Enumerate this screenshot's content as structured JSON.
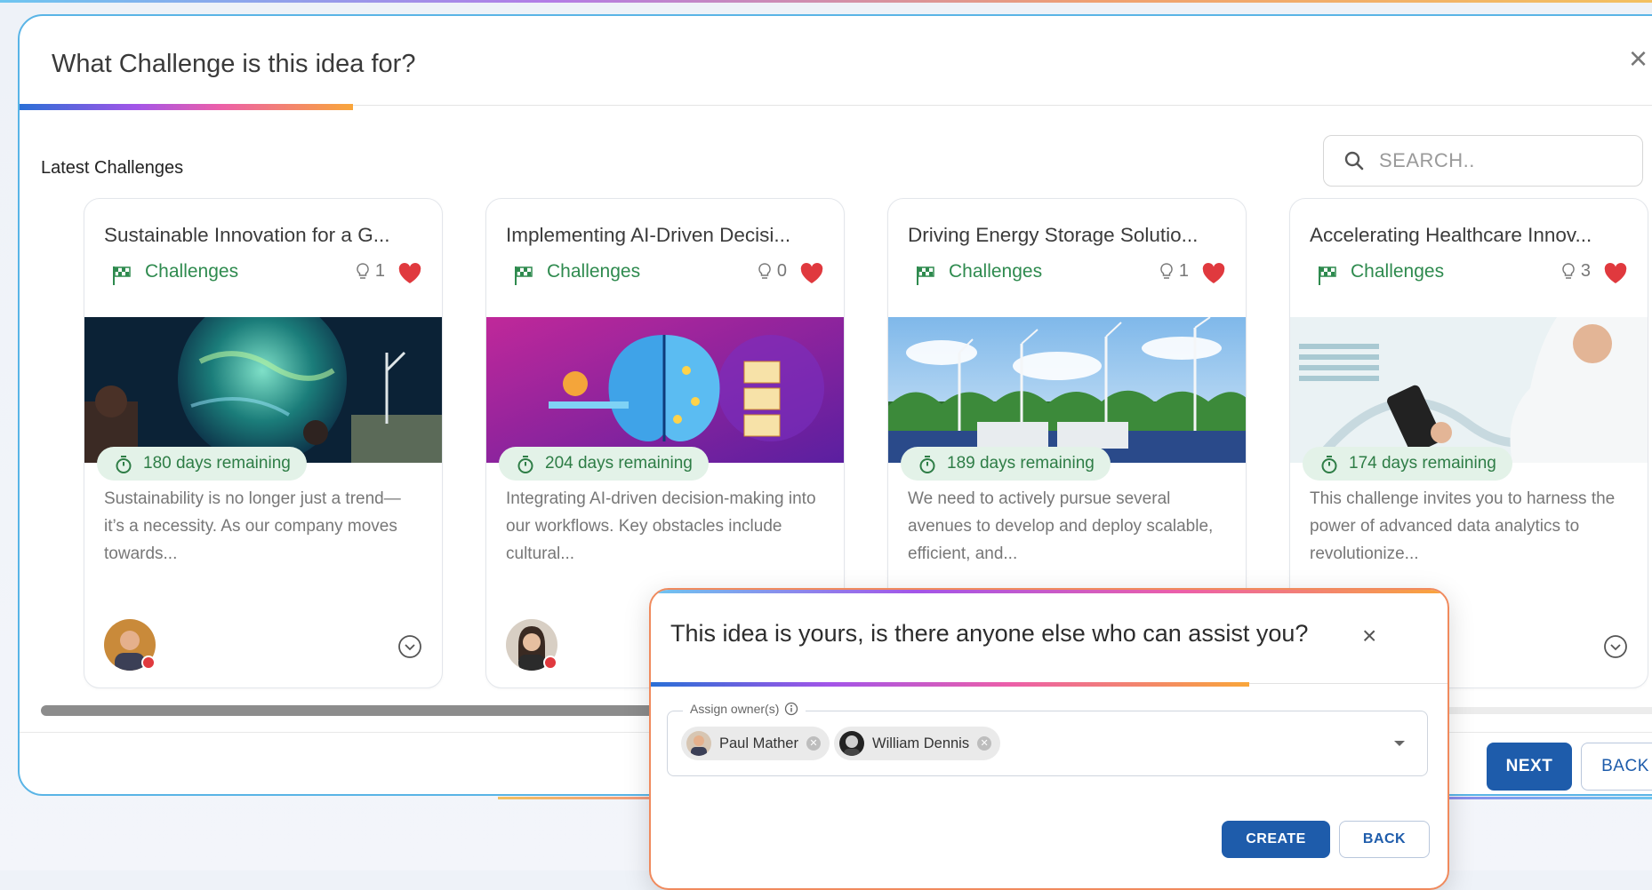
{
  "modal": {
    "title": "What Challenge is this idea for?",
    "close_icon": "×",
    "section_label": "Latest Challenges",
    "search_placeholder": "SEARCH..",
    "next_label": "NEXT",
    "back_label": "BACK"
  },
  "cards": [
    {
      "title": "Sustainable Innovation for a G...",
      "category": "Challenges",
      "idea_count": "1",
      "days": "180 days remaining",
      "description": "Sustainability is no longer just a trend—it’s a necessity. As our company moves towards...",
      "image": "globe-technology"
    },
    {
      "title": "Implementing AI-Driven Decisi...",
      "category": "Challenges",
      "idea_count": "0",
      "days": "204 days remaining",
      "description": "Integrating AI-driven decision-making into our workflows. Key obstacles include cultural...",
      "image": "ai-brain"
    },
    {
      "title": "Driving Energy Storage Solutio...",
      "category": "Challenges",
      "idea_count": "1",
      "days": "189 days remaining",
      "description": "We need to actively pursue several avenues to develop and deploy scalable, efficient, and...",
      "image": "wind-turbines"
    },
    {
      "title": "Accelerating Healthcare Innov...",
      "category": "Challenges",
      "idea_count": "3",
      "days": "174 days remaining",
      "description": "This challenge invites you to harness the power of advanced data analytics to revolutionize...",
      "image": "healthcare-scientist"
    }
  ],
  "dialog": {
    "title": "This idea is yours, is there anyone else who can assist you?",
    "close_icon": "×",
    "field_label": "Assign owner(s)",
    "info_icon": "i",
    "owners": [
      "Paul Mather",
      "William Dennis"
    ],
    "create_label": "CREATE",
    "back_label": "BACK"
  },
  "colors": {
    "primary": "#1e5cab",
    "category_green": "#2e8a4e",
    "heart_red": "#e0393e",
    "days_bg": "#e3f2e8"
  }
}
